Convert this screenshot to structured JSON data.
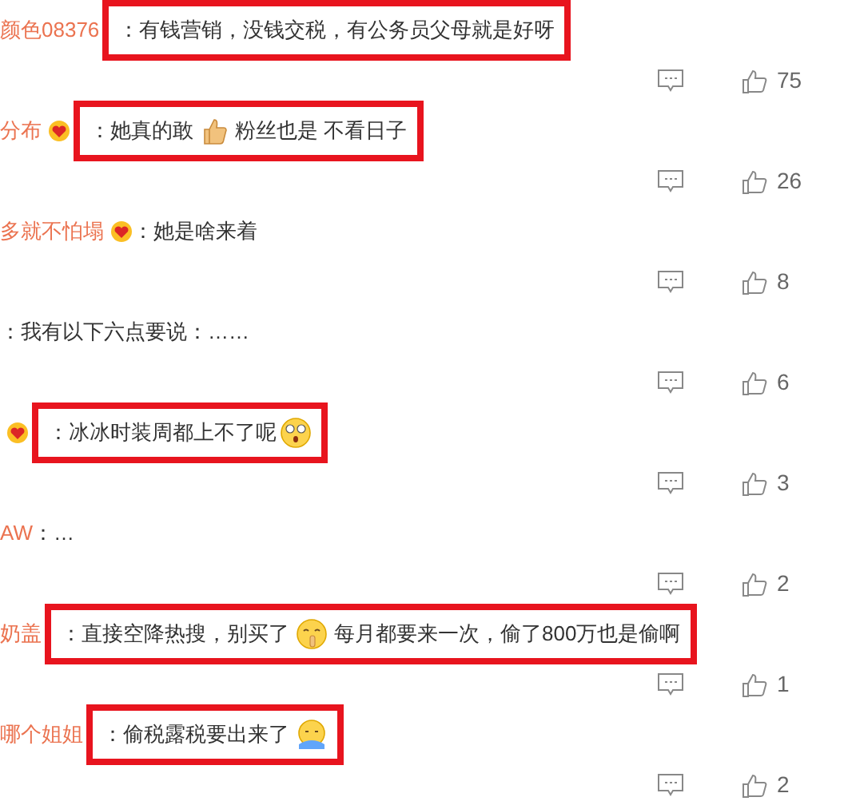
{
  "comments": [
    {
      "user": "颜色08376",
      "badge": false,
      "highlighted": true,
      "colon": "：",
      "parts": [
        {
          "kind": "text",
          "text": "有钱营销，没钱交税，有公务员父母就是好呀"
        }
      ],
      "likes": "75"
    },
    {
      "user": "分布",
      "badge": true,
      "highlighted": true,
      "colon": "：",
      "parts": [
        {
          "kind": "text",
          "text": "她真的敢"
        },
        {
          "kind": "thumb"
        },
        {
          "kind": "text",
          "text": "粉丝也是 不看日子"
        }
      ],
      "likes": "26"
    },
    {
      "user": "多就不怕塌",
      "badge": true,
      "highlighted": false,
      "colon": "：",
      "parts": [
        {
          "kind": "text",
          "text": "她是啥来着"
        }
      ],
      "likes": "8"
    },
    {
      "badge": false,
      "highlighted": false,
      "colon": "：",
      "parts": [
        {
          "kind": "text",
          "text": "我有以下六点要说：……"
        }
      ],
      "likes": "6"
    },
    {
      "badge": true,
      "highlighted": true,
      "colon": "：",
      "parts": [
        {
          "kind": "text",
          "text": "冰冰时装周都上不了呢"
        },
        {
          "kind": "shock"
        }
      ],
      "likes": "3"
    },
    {
      "user": "AW",
      "badge": false,
      "highlighted": false,
      "colon": "：",
      "parts": [
        {
          "kind": "text",
          "text": "…"
        }
      ],
      "likes": "2"
    },
    {
      "user": "奶盖",
      "badge": false,
      "highlighted": true,
      "colon": "：",
      "parts": [
        {
          "kind": "text",
          "text": "直接空降热搜，别买了"
        },
        {
          "kind": "shush"
        },
        {
          "kind": "text",
          "text": "每月都要来一次，偷了800万也是偷啊"
        }
      ],
      "likes": "1"
    },
    {
      "user": "哪个姐姐",
      "badge": false,
      "highlighted": true,
      "colon": "：",
      "parts": [
        {
          "kind": "text",
          "text": "偷税露税要出来了"
        },
        {
          "kind": "cry"
        }
      ],
      "likes": "2"
    }
  ]
}
